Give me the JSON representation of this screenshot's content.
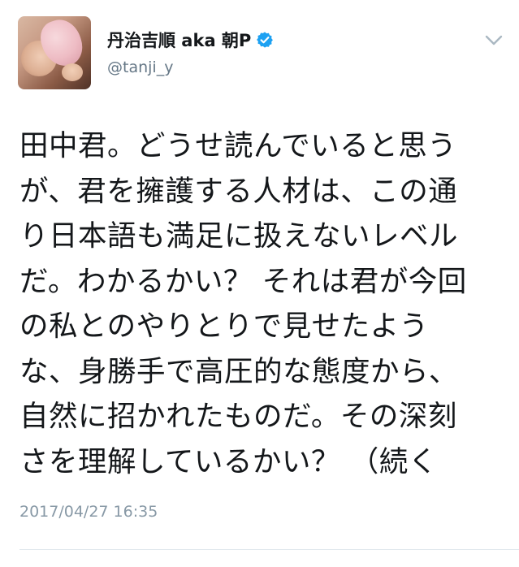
{
  "tweet": {
    "author": {
      "display_name": "丹治吉順 aka 朝P",
      "handle": "@tanji_y",
      "verified": true
    },
    "icons": {
      "verified": "verified-badge-icon",
      "caret": "chevron-down-icon"
    },
    "body_lines": [
      "田中君。どうせ読んでいると思う",
      "が、君を擁護する人材は、この通",
      "り日本語も満足に扱えないレベル",
      "だ。わかるかい？ それは君が今回",
      "の私とのやりとりで見せたよう",
      "な、身勝手で高圧的な態度から、",
      "自然に招かれたものだ。その深刻",
      "さを理解しているかい？ （続く"
    ],
    "timestamp": "2017/04/27 16:35",
    "colors": {
      "text": "#14171a",
      "secondary": "#657786",
      "timestamp": "#8899a6",
      "verified_blue": "#1da1f2",
      "divider": "#e1e8ed"
    }
  }
}
